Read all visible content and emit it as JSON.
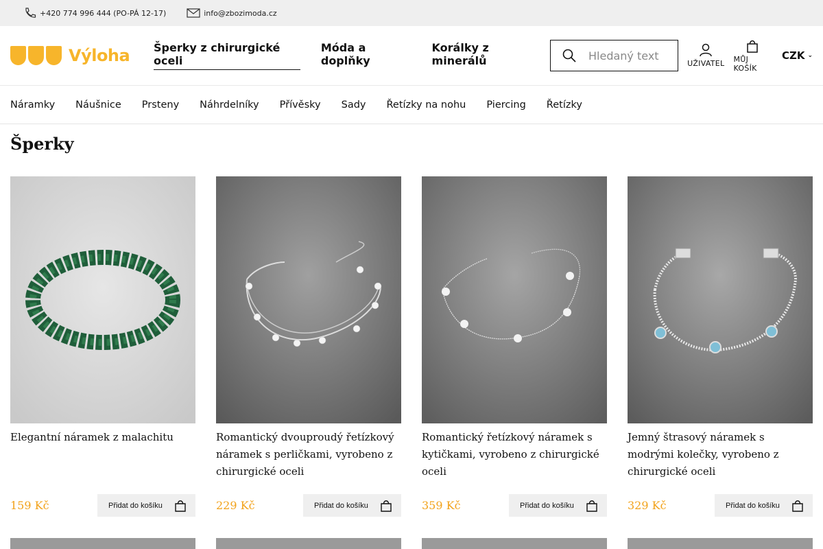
{
  "topbar": {
    "phone": "+420 774 996 444 (PO-PÁ 12-17)",
    "email": "info@zbozimoda.cz"
  },
  "header": {
    "logo_text": "Výloha",
    "nav": [
      "Šperky z chirurgické oceli",
      "Móda a doplňky",
      "Korálky z minerálů"
    ],
    "search_placeholder": "Hledaný text",
    "user_label": "UŽIVATEL",
    "cart_label": "MŮJ KOŠÍK",
    "currency": "CZK"
  },
  "subnav": [
    "Náramky",
    "Náušnice",
    "Prsteny",
    "Náhrdelníky",
    "Přívěsky",
    "Sady",
    "Řetízky na nohu",
    "Piercing",
    "Řetízky"
  ],
  "page_title": "Šperky",
  "products": [
    {
      "name": "Elegantní náramek z malachitu",
      "price": "159 Kč",
      "button": "Přidat do košíku"
    },
    {
      "name": "Romantický dvouproudý řetízkový náramek s perličkami, vyrobeno z chirurgické oceli",
      "price": "229 Kč",
      "button": "Přidat do košíku"
    },
    {
      "name": "Romantický řetízkový náramek s kytičkami, vyrobeno z chirurgické oceli",
      "price": "359 Kč",
      "button": "Přidat do košíku"
    },
    {
      "name": "Jemný štrasový náramek s modrými kolečky, vyrobeno z chirurgické oceli",
      "price": "329 Kč",
      "button": "Přidat do košíku"
    }
  ],
  "colors": {
    "accent": "#f7b52b",
    "price": "#f2a21a"
  }
}
